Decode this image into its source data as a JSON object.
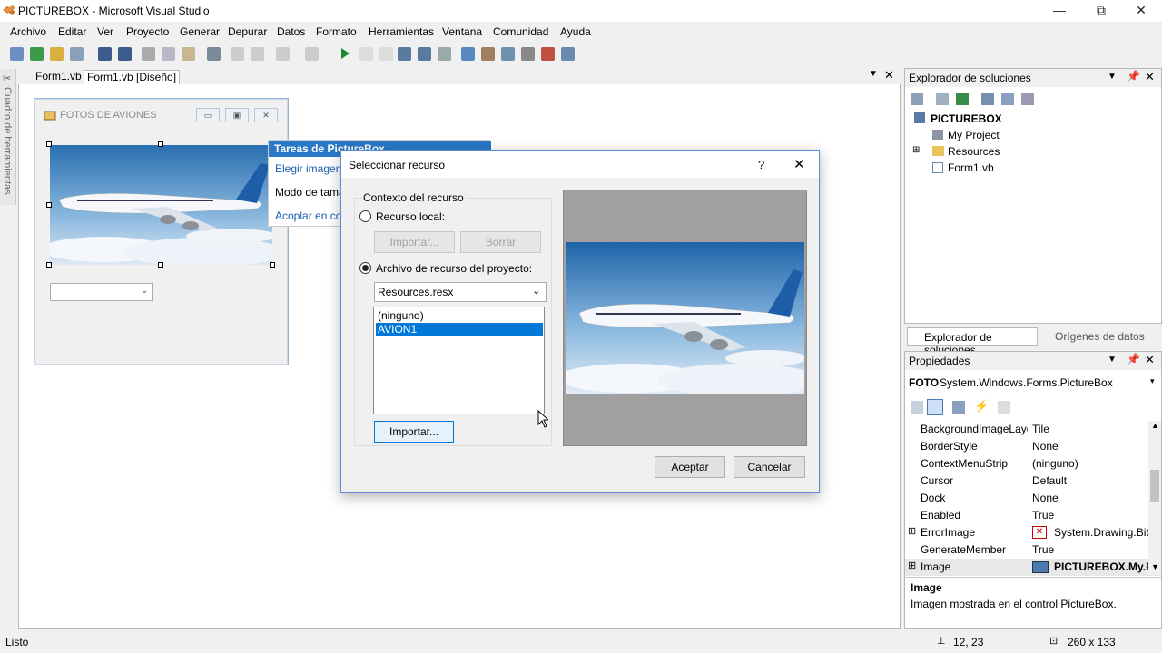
{
  "window": {
    "title": "PICTUREBOX - Microsoft Visual Studio",
    "min": "—",
    "max": "⧉",
    "close": "✕"
  },
  "menu": [
    "Archivo",
    "Editar",
    "Ver",
    "Proyecto",
    "Generar",
    "Depurar",
    "Datos",
    "Formato",
    "Herramientas",
    "Ventana",
    "Comunidad",
    "Ayuda"
  ],
  "toolbox": {
    "label": "Cuadro de herramientas"
  },
  "tabs": {
    "code": "Form1.vb",
    "design": "Form1.vb [Diseño]"
  },
  "designer": {
    "form_title": "FOTOS DE AVIONES"
  },
  "smart_tag": {
    "header": "Tareas de PictureBox",
    "choose_image": "Elegir imagen",
    "size_mode": "Modo de tama",
    "dock": "Acoplar en cor"
  },
  "dialog": {
    "title": "Seleccionar recurso",
    "help": "?",
    "close": "✕",
    "group": "Contexto del recurso",
    "local": "Recurso local:",
    "import_disabled": "Importar...",
    "delete": "Borrar",
    "project": "Archivo de recurso del proyecto:",
    "resx": "Resources.resx",
    "list": [
      "(ninguno)",
      "AVION1"
    ],
    "import": "Importar...",
    "ok": "Aceptar",
    "cancel": "Cancelar"
  },
  "solution": {
    "title": "Explorador de soluciones",
    "tree": [
      "PICTUREBOX",
      "My Project",
      "Resources",
      "Form1.vb"
    ],
    "tab1": "Explorador de soluciones",
    "tab2": "Orígenes de datos"
  },
  "properties": {
    "title": "Propiedades",
    "object": "FOTO",
    "object_type": "System.Windows.Forms.PictureBox",
    "rows": [
      {
        "n": "BackgroundImageLayou",
        "v": "Tile"
      },
      {
        "n": "BorderStyle",
        "v": "None"
      },
      {
        "n": "ContextMenuStrip",
        "v": "(ninguno)"
      },
      {
        "n": "Cursor",
        "v": "Default"
      },
      {
        "n": "Dock",
        "v": "None"
      },
      {
        "n": "Enabled",
        "v": "True"
      },
      {
        "n": "ErrorImage",
        "v": "System.Drawing.Bitm"
      },
      {
        "n": "GenerateMember",
        "v": "True"
      },
      {
        "n": "Image",
        "v": "PICTUREBOX.My.Re"
      }
    ],
    "desc_title": "Image",
    "desc_text": "Imagen mostrada en el control PictureBox."
  },
  "status": {
    "text": "Listo",
    "position": "12, 23",
    "size": "260 x 133"
  }
}
